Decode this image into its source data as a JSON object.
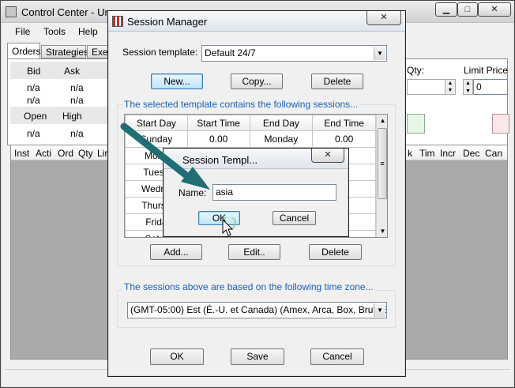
{
  "main_window": {
    "title": "Control Center - Unti",
    "menu": [
      "File",
      "Tools",
      "Help"
    ],
    "tabs": [
      "Orders",
      "Strategies",
      "Exec"
    ],
    "quote_headers_1": [
      "Bid",
      "Ask"
    ],
    "quote_values_1a": [
      "n/a",
      "n/a"
    ],
    "quote_values_1b": [
      "n/a",
      "n/a"
    ],
    "quote_headers_2": [
      "Open",
      "High"
    ],
    "quote_values_2": [
      "n/a",
      "n/a"
    ],
    "order_columns_left": [
      "Inst",
      "Acti",
      "Ord",
      "Qty",
      "Lir"
    ],
    "order_columns_right": [
      "k",
      "Tim",
      "Incr",
      "Dec",
      "Can"
    ],
    "qty_label": "Qty:",
    "limit_price_label": "Limit Price",
    "limit_price_value": "0"
  },
  "session_manager": {
    "title": "Session Manager",
    "template_label": "Session template:",
    "template_value": "Default 24/7",
    "new_button": "New...",
    "copy_button": "Copy...",
    "delete_button": "Delete",
    "sessions_legend": "The selected template contains the following sessions...",
    "columns": [
      "Start Day",
      "Start Time",
      "End Day",
      "End Time"
    ],
    "rows": [
      [
        "Sunday",
        "0.00",
        "Monday",
        "0.00"
      ],
      [
        "Mond",
        "",
        "",
        ""
      ],
      [
        "Tuesd",
        "",
        "",
        ""
      ],
      [
        "Wedne",
        "",
        "",
        ""
      ],
      [
        "Thursd",
        "",
        "",
        ""
      ],
      [
        "Frida",
        "",
        "",
        ""
      ],
      [
        "Satur",
        "",
        "",
        ""
      ]
    ],
    "add_button": "Add...",
    "edit_button": "Edit..",
    "delete_session_button": "Delete",
    "timezone_legend": "The sessions above are based on the following time zone...",
    "timezone_value": "(GMT-05:00) Est (É.-U. et Canada) (Amex, Arca, Box, Brut, Eurex",
    "ok_button": "OK",
    "save_button": "Save",
    "cancel_button": "Cancel"
  },
  "session_template_dialog": {
    "title": "Session Templ...",
    "name_label": "Name:",
    "name_value": "asia",
    "ok_button": "OK",
    "cancel_button": "Cancel"
  },
  "colors": {
    "legend_text": "#1a5fb4",
    "dialog_bg": "#f0f0f0",
    "arrow": "#1f6e73"
  },
  "icons": [
    "session-manager-icon",
    "close-icon",
    "minimize-icon",
    "maximize-icon",
    "scroll-up-icon",
    "scroll-down-icon",
    "dropdown-arrow-icon",
    "pointer-arrow-icon"
  ]
}
